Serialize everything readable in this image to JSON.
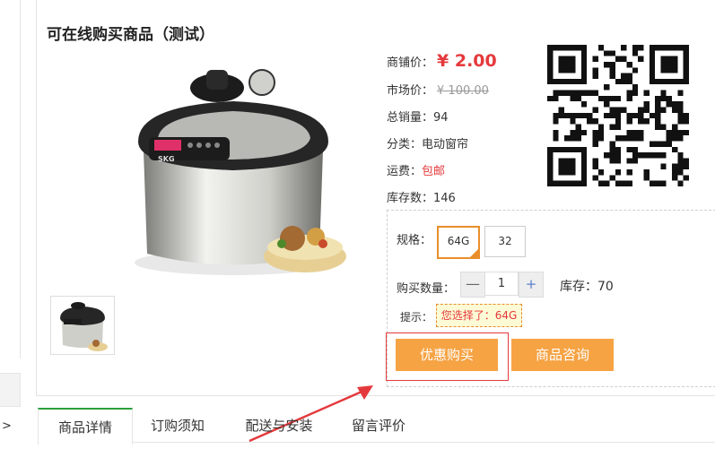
{
  "left_panel": {
    "arrow": ">"
  },
  "product": {
    "title": "可在线购买商品（测试）",
    "price_label": "商铺价：",
    "price": "¥ 2.00",
    "market_price_label": "市场价：",
    "market_price": "¥ 100.00",
    "sales_label": "总销量：",
    "sales": "94",
    "category_label": "分类：",
    "category": "电动窗帘",
    "shipping_label": "运费：",
    "shipping": "包邮",
    "stock_label": "库存数：",
    "stock": "146",
    "main_image_brand": "SKG"
  },
  "options": {
    "spec_label": "规格：",
    "specs": [
      "64G",
      "32"
    ],
    "selected_spec": "64G",
    "qty_label": "购买数量：",
    "qty_minus": "—",
    "qty_value": "1",
    "qty_plus": "+",
    "stock_info": "库存：70",
    "tip_label": "提示：",
    "tip_value": "您选择了：64G"
  },
  "buttons": {
    "buy": "优惠购买",
    "consult": "商品咨询"
  },
  "tabs": [
    "商品详情",
    "订购须知",
    "配送与安装",
    "留言评价"
  ],
  "colors": {
    "accent_orange": "#f6a344",
    "price_red": "#e4393c",
    "tab_green": "#2aa03b"
  }
}
